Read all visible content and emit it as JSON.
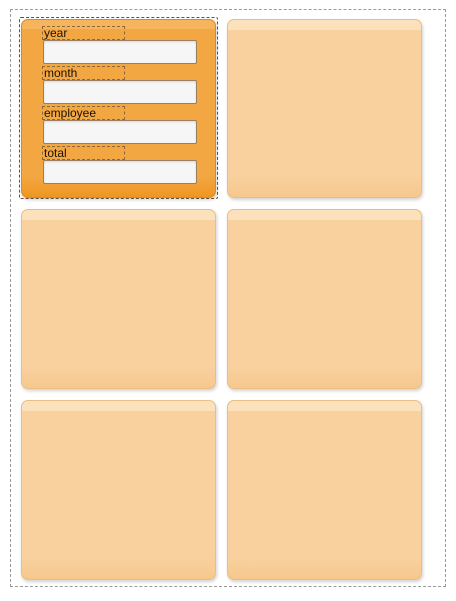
{
  "form": {
    "fields": [
      {
        "label": "year",
        "value": "",
        "placeholder": ""
      },
      {
        "label": "month",
        "value": "",
        "placeholder": ""
      },
      {
        "label": "employee",
        "value": "",
        "placeholder": ""
      },
      {
        "label": "total",
        "value": "",
        "placeholder": ""
      }
    ]
  },
  "colors": {
    "active_tile": "#f3a743",
    "inactive_tile": "#f8d19f",
    "input_background": "#f6f6f6"
  }
}
